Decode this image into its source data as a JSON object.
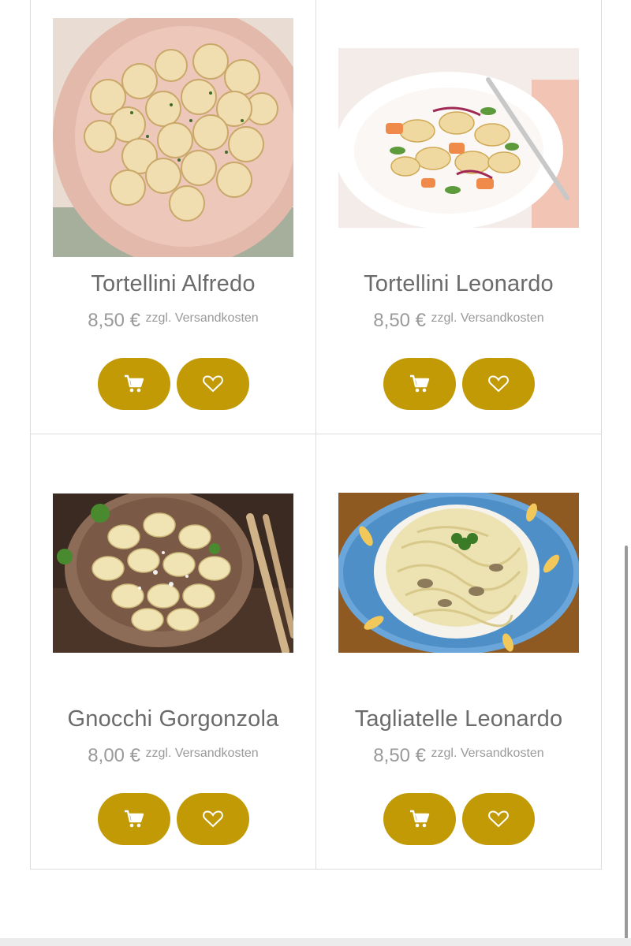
{
  "products": [
    {
      "name": "Tortellini Alfredo",
      "price": "8,50 €",
      "shipping_note": "zzgl. Versandkosten",
      "image": "tortellini-alfredo-photo",
      "cart_icon": "cart-icon",
      "wishlist_icon": "heart-icon"
    },
    {
      "name": "Tortellini Leonardo",
      "price": "8,50 €",
      "shipping_note": "zzgl. Versandkosten",
      "image": "tortellini-leonardo-photo",
      "cart_icon": "cart-icon",
      "wishlist_icon": "heart-icon"
    },
    {
      "name": "Gnocchi Gorgonzola",
      "price": "8,00 €",
      "shipping_note": "zzgl. Versandkosten",
      "image": "gnocchi-gorgonzola-photo",
      "cart_icon": "cart-icon",
      "wishlist_icon": "heart-icon"
    },
    {
      "name": "Tagliatelle Leonardo",
      "price": "8,50 €",
      "shipping_note": "zzgl. Versandkosten",
      "image": "tagliatelle-leonardo-photo",
      "cart_icon": "cart-icon",
      "wishlist_icon": "heart-icon"
    }
  ],
  "colors": {
    "accent": "#c19a06",
    "title_text": "#6b6b6b",
    "price_text": "#9a9a9a",
    "border": "#dcdcdc"
  }
}
